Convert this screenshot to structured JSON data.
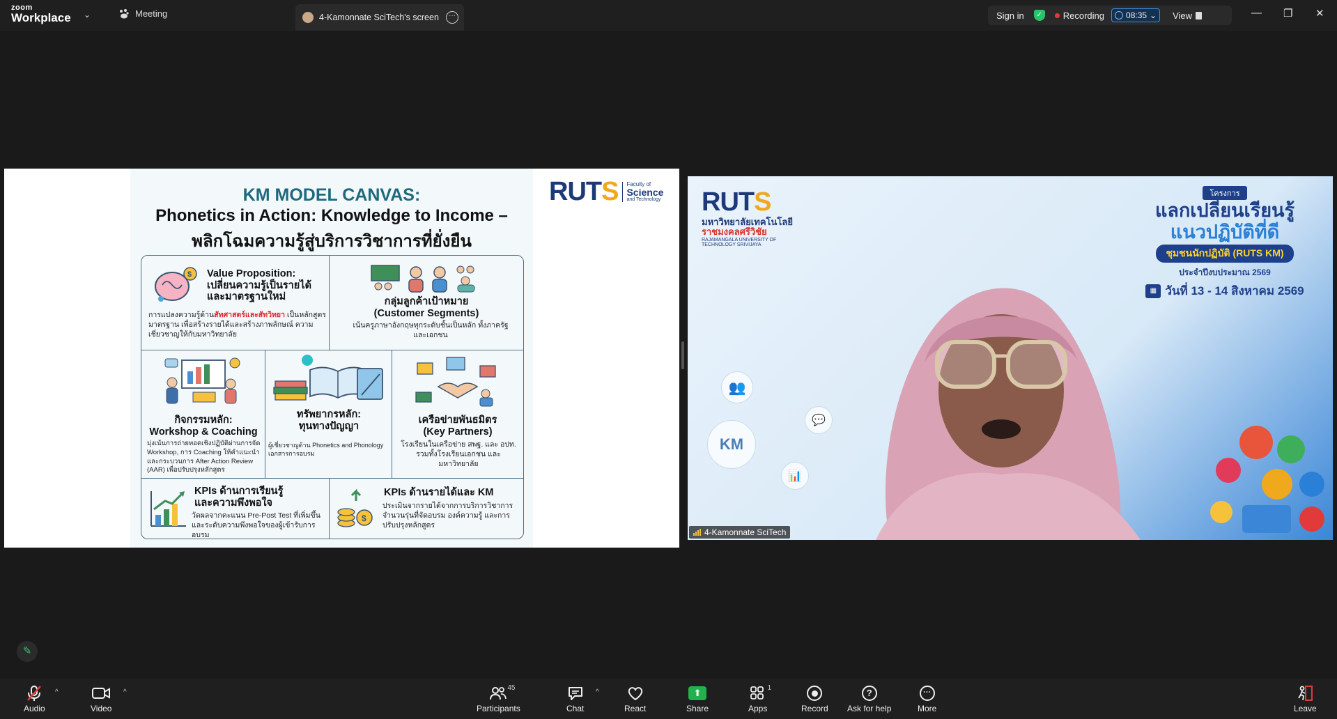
{
  "topbar": {
    "logo_top": "zoom",
    "logo_bottom": "Workplace",
    "meeting_label": "Meeting",
    "screen_tab_label": "4-Kamonnate SciTech's screen",
    "sign_in": "Sign in",
    "recording": "Recording",
    "timer": "08:35",
    "view": "View"
  },
  "slide": {
    "logo_main": "RUT",
    "logo_s": "S",
    "logo_sub1": "Faculty of",
    "logo_sub2": "Science",
    "logo_sub3": "and Technology",
    "title1": "KM MODEL CANVAS:",
    "title2": "Phonetics in Action: Knowledge to Income –",
    "title3": "พลิกโฉมความรู้สู่บริการวิชาการที่ยั่งยืน",
    "value_title1": "Value Proposition:",
    "value_title2": "เปลี่ยนความรู้เป็นรายได้",
    "value_title3": "และมาตรฐานใหม่",
    "value_desc_pre": "การแปลงความรู้ด้าน",
    "value_desc_hl": "สัทศาสตร์และสัทวิทยา",
    "value_desc_post": " เป็นหลักสูตรมาตรฐาน เพื่อสร้างรายได้และสร้างภาพลักษณ์ ความเชี่ยวชาญให้กับมหาวิทยาลัย",
    "customer_title1": "กลุ่มลูกค้าเป้าหมาย",
    "customer_title2": "(Customer Segments)",
    "customer_desc": "เน้นครูภาษาอังกฤษทุกระดับชั้นเป็นหลัก ทั้งภาครัฐและเอกชน",
    "activity_title1": "กิจกรรมหลัก:",
    "activity_title2": "Workshop & Coaching",
    "activity_desc": "มุ่งเน้นการถ่ายทอดเชิงปฏิบัติผ่านการจัด Workshop, การ Coaching ให้คำแนะนำ และกระบวนการ After Action Review (AAR) เพื่อปรับปรุงหลักสูตร",
    "resource_title1": "ทรัพยากรหลัก:",
    "resource_title2": "ทุนทางปัญญา",
    "resource_desc": "ผู้เชี่ยวชาญด้าน Phonetics and Phonology เอกสารการอบรม",
    "partner_title1": "เครือข่ายพันธมิตร",
    "partner_title2": "(Key Partners)",
    "partner_desc": "โรงเรียนในเครือข่าย สพฐ. และ อปท. รวมทั้งโรงเรียนเอกชน และมหาวิทยาลัย",
    "kpi1_title1": "KPIs ด้านการเรียนรู้",
    "kpi1_title2": "และความพึงพอใจ",
    "kpi1_desc": "วัดผลจากคะแนน Pre-Post Test ที่เพิ่มขึ้น และระดับความพึงพอใจของผู้เข้ารับการอบรม",
    "kpi2_title": "KPIs ด้านรายได้และ KM",
    "kpi2_desc": "ประเมินจากรายได้จากการบริการวิชาการ จำนวนรุ่นที่จัดอบรม องค์ความรู้ และการปรับปรุงหลักสูตร"
  },
  "video": {
    "logo_main": "RUT",
    "logo_s": "S",
    "uni_th1": "มหาวิทยาลัยเทคโนโลยี",
    "uni_th2": "ราชมงคลศรีวิชัย",
    "uni_en1": "RAJAMANGALA UNIVERSITY OF",
    "uni_en2": "TECHNOLOGY SRIVIJAYA",
    "ban_tag": "โครงการ",
    "ban_l1": "แลกเปลี่ยนเรียนรู้",
    "ban_l2": "แนวปฏิบัติที่ดี",
    "ban_l3": "ชุมชนนักปฏิบัติ (RUTS KM)",
    "ban_l4": "ประจำปีงบประมาณ 2569",
    "ban_l5": "วันที่ 13 - 14 สิงหาคม 2569",
    "km_bubble": "KM",
    "participant_name": "4-Kamonnate SciTech"
  },
  "toolbar": {
    "audio": "Audio",
    "video": "Video",
    "participants": "Participants",
    "participants_count": "45",
    "chat": "Chat",
    "react": "React",
    "share": "Share",
    "apps": "Apps",
    "apps_count": "1",
    "record": "Record",
    "ask": "Ask for help",
    "more": "More",
    "leave": "Leave"
  },
  "colors": {
    "accent_green": "#22b14c",
    "recording_red": "#e23a3a",
    "ruts_blue": "#1d3a78",
    "ruts_orange": "#f0a81c"
  }
}
